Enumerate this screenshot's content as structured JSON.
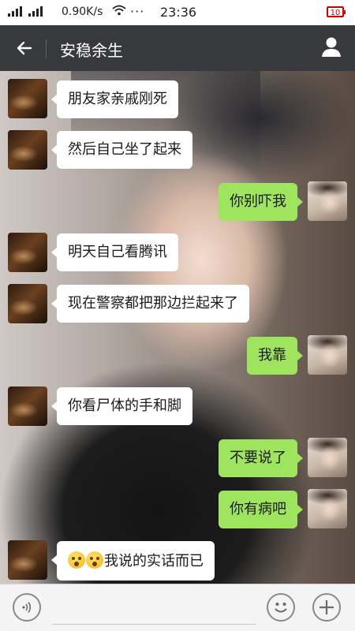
{
  "status_bar": {
    "speed": "0.90K/s",
    "wifi_icon": "wifi-icon",
    "dots": "···",
    "time": "23:36",
    "battery": "10",
    "battery_color": "#cc0000"
  },
  "header": {
    "back_icon": "arrow-left-icon",
    "title": "安稳余生",
    "profile_icon": "person-icon",
    "background": "#38393d"
  },
  "messages": [
    {
      "side": "in",
      "text": "朋友家亲戚刚死"
    },
    {
      "side": "in",
      "text": "然后自己坐了起来"
    },
    {
      "side": "out",
      "text": "你别吓我"
    },
    {
      "side": "in",
      "text": "明天自己看腾讯"
    },
    {
      "side": "in",
      "text": "现在警察都把那边拦起来了"
    },
    {
      "side": "out",
      "text": "我靠"
    },
    {
      "side": "in",
      "text": "你看尸体的手和脚"
    },
    {
      "side": "out",
      "text": "不要说了"
    },
    {
      "side": "out",
      "text": "你有病吧"
    },
    {
      "side": "in",
      "text": "我说的实话而已",
      "prefix_emojis": [
        "dizzy-face-emoji",
        "dizzy-face-emoji"
      ]
    }
  ],
  "colors": {
    "incoming_bubble": "#ffffff",
    "outgoing_bubble": "#9fe45e"
  },
  "bottom_bar": {
    "voice_icon": "voice-icon",
    "emoji_icon": "smiley-icon",
    "plus_icon": "plus-icon"
  }
}
